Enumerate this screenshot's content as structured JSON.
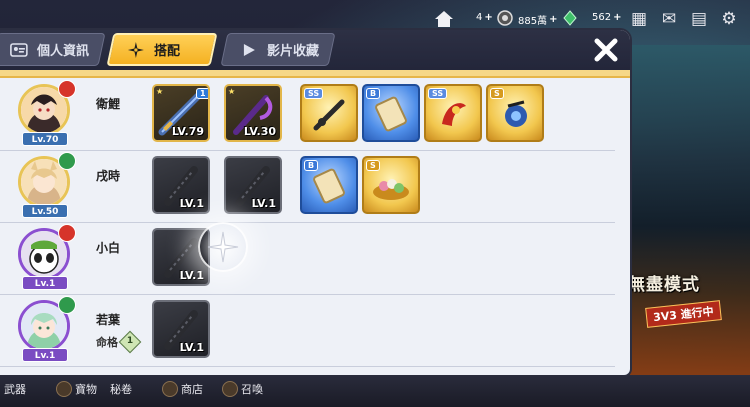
{
  "hud": {
    "currency1": "4",
    "currency2": "885萬",
    "currency3": "562"
  },
  "tabs": [
    {
      "label": "個人資訊",
      "active": false
    },
    {
      "label": "搭配",
      "active": true
    },
    {
      "label": "影片收藏",
      "active": false
    }
  ],
  "close_label": "✕",
  "background": {
    "mode_text": "無盡模式",
    "badge_3v3": "3V3 進行中"
  },
  "characters": [
    {
      "name": "衛鯉",
      "level": "Lv.70",
      "element": "fire",
      "sub": "",
      "weapons": [
        {
          "level": "LV.79",
          "style": "gold",
          "badge": "1"
        },
        {
          "level": "LV.30",
          "style": "gold",
          "badge": ""
        }
      ],
      "items": [
        {
          "grade": "SS",
          "style": "gold"
        },
        {
          "grade": "B",
          "style": "blue"
        },
        {
          "grade": "SS",
          "style": "gold"
        },
        {
          "grade": "S",
          "style": "gold"
        }
      ]
    },
    {
      "name": "戌時",
      "level": "Lv.50",
      "element": "wind",
      "sub": "",
      "weapons": [
        {
          "level": "LV.1",
          "style": "empty",
          "badge": ""
        },
        {
          "level": "LV.1",
          "style": "empty",
          "badge": ""
        }
      ],
      "items": [
        {
          "grade": "B",
          "style": "blue"
        },
        {
          "grade": "S",
          "style": "gold"
        }
      ]
    },
    {
      "name": "小白",
      "level": "Lv.1",
      "element": "fire",
      "sub": "",
      "weapons": [
        {
          "level": "LV.1",
          "style": "empty",
          "badge": ""
        }
      ],
      "items": []
    },
    {
      "name": "若葉",
      "level": "Lv.1",
      "element": "wind",
      "sub": "命格",
      "sub_badge": "1",
      "weapons": [
        {
          "level": "LV.1",
          "style": "empty",
          "badge": ""
        }
      ],
      "items": []
    }
  ],
  "bottom_nav": [
    {
      "label": "武器"
    },
    {
      "label": "寶物"
    },
    {
      "label": "秘卷"
    },
    {
      "label": "商店"
    },
    {
      "label": "召喚"
    }
  ]
}
